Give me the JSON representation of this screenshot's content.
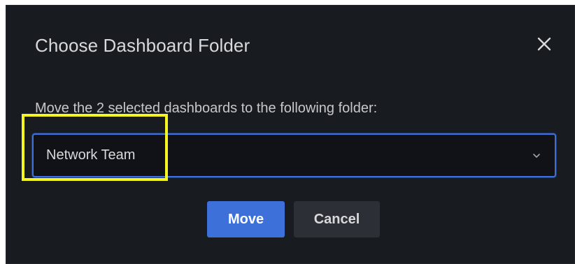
{
  "dialog": {
    "title": "Choose Dashboard Folder",
    "close_icon": "close-icon",
    "description": "Move the 2 selected dashboards to the following folder:"
  },
  "folder_select": {
    "value": "Network Team",
    "chevron_icon": "chevron-down-icon"
  },
  "buttons": {
    "move_label": "Move",
    "cancel_label": "Cancel"
  },
  "colors": {
    "background": "#181b1f",
    "primary": "#3d71d9",
    "secondary": "#2c2f35",
    "highlight": "#f5f51f",
    "text": "#d8d9da"
  }
}
